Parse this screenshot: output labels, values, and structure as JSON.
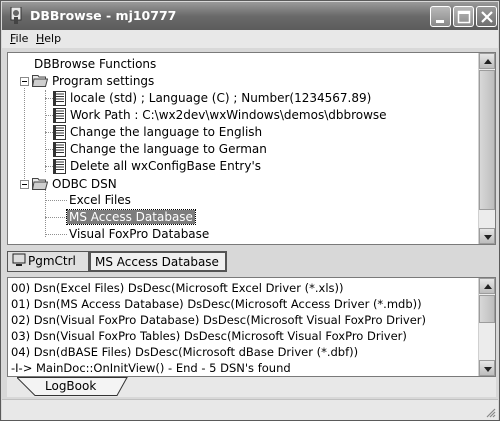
{
  "window": {
    "title": "DBBrowse - mj10777",
    "app_icon": "dbbrowse-app-icon"
  },
  "menubar": {
    "items": [
      {
        "label_acc": "F",
        "label_rest": "ile"
      },
      {
        "label_acc": "H",
        "label_rest": "elp"
      }
    ]
  },
  "tree": {
    "root": "DBBrowse Functions",
    "program_settings": {
      "label": "Program settings",
      "children": [
        "locale (std) ; Language (C) ; Number(1234567.89)",
        "Work Path : C:\\wx2dev\\wxWindows\\demos\\dbbrowse",
        "Change the language to English",
        "Change the language to German",
        "Delete all wxConfigBase Entry's"
      ]
    },
    "odbc_dsn": {
      "label": "ODBC DSN",
      "children": [
        "Excel Files",
        "MS Access Database",
        "Visual FoxPro Database"
      ],
      "selected": "MS Access Database"
    }
  },
  "tabs": {
    "pgmctrl": "PgmCtrl",
    "active": "MS Access Database"
  },
  "log": {
    "lines": [
      "00) Dsn(Excel Files) DsDesc(Microsoft Excel Driver (*.xls))",
      "01) Dsn(MS Access Database) DsDesc(Microsoft Access Driver (*.mdb))",
      "02) Dsn(Visual FoxPro Database) DsDesc(Microsoft Visual FoxPro Driver)",
      "03) Dsn(Visual FoxPro Tables) DsDesc(Microsoft Visual FoxPro Driver)",
      "04) Dsn(dBASE Files) DsDesc(Microsoft dBase Driver (*.dbf))",
      "-I-> MainDoc::OnInitView() - End - 5 DSN's found"
    ],
    "tab_label": "LogBook"
  }
}
